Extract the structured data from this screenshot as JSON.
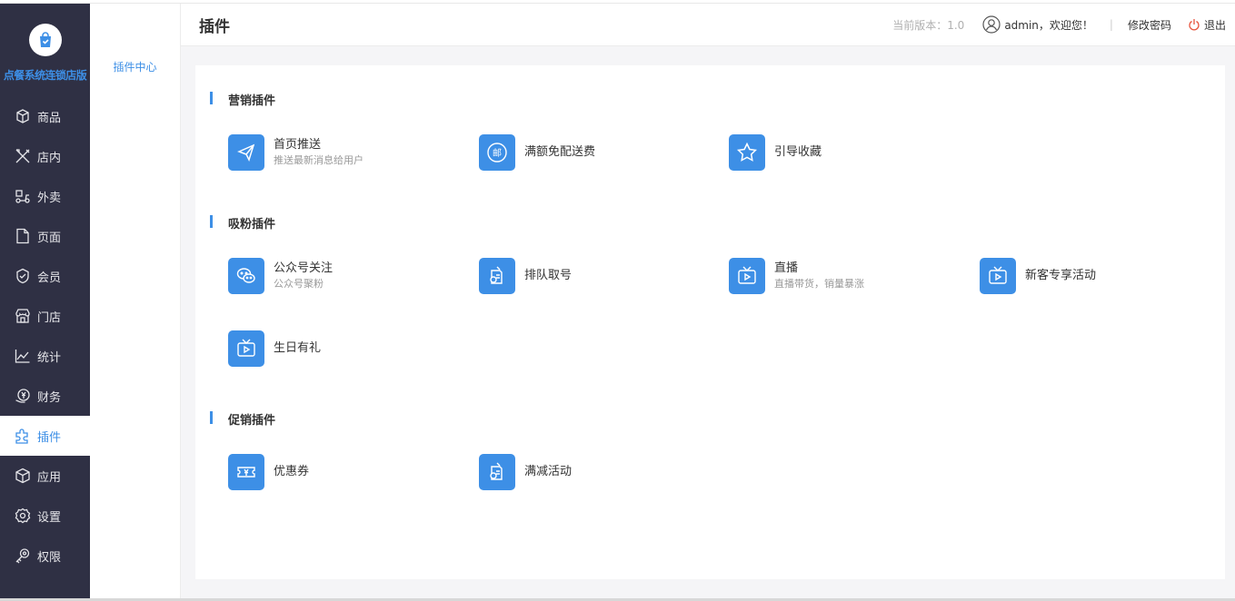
{
  "app": {
    "shop_name": "点餐系统连锁店版"
  },
  "nav": [
    {
      "label": "商品",
      "icon": "box-icon"
    },
    {
      "label": "店内",
      "icon": "utensils-icon"
    },
    {
      "label": "外卖",
      "icon": "scooter-icon"
    },
    {
      "label": "页面",
      "icon": "page-icon"
    },
    {
      "label": "会员",
      "icon": "member-icon"
    },
    {
      "label": "门店",
      "icon": "store-icon"
    },
    {
      "label": "统计",
      "icon": "chart-icon"
    },
    {
      "label": "财务",
      "icon": "finance-icon"
    },
    {
      "label": "插件",
      "icon": "puzzle-icon",
      "active": true
    },
    {
      "label": "应用",
      "icon": "cube-icon"
    },
    {
      "label": "设置",
      "icon": "gear-icon"
    },
    {
      "label": "权限",
      "icon": "key-icon"
    }
  ],
  "subnav": {
    "item": "插件中心"
  },
  "header": {
    "title": "插件",
    "version": "当前版本：1.0",
    "user": "admin，欢迎您！",
    "separator": "|",
    "change_password": "修改密码",
    "logout": "退出"
  },
  "sections": {
    "marketing": {
      "title": "营销插件",
      "items": [
        {
          "name": "首页推送",
          "desc": "推送最新消息给用户",
          "icon": "send-icon"
        },
        {
          "name": "满额免配送费",
          "desc": "",
          "icon": "mail-badge-icon"
        },
        {
          "name": "引导收藏",
          "desc": "",
          "icon": "star-icon"
        }
      ]
    },
    "fans": {
      "title": "吸粉插件",
      "items": [
        {
          "name": "公众号关注",
          "desc": "公众号聚粉",
          "icon": "wechat-icon"
        },
        {
          "name": "排队取号",
          "desc": "",
          "icon": "queue-ticket-icon"
        },
        {
          "name": "直播",
          "desc": "直播带货，销量暴涨",
          "icon": "live-tv-icon"
        },
        {
          "name": "新客专享活动",
          "desc": "",
          "icon": "live-tv-icon"
        },
        {
          "name": "生日有礼",
          "desc": "",
          "icon": "live-tv-icon"
        }
      ]
    },
    "promo": {
      "title": "促销插件",
      "items": [
        {
          "name": "优惠券",
          "desc": "",
          "icon": "coupon-icon"
        },
        {
          "name": "满减活动",
          "desc": "",
          "icon": "queue-ticket-icon"
        }
      ]
    }
  },
  "colors": {
    "sidebar_bg": "#2f3044",
    "accent": "#3d8fe6"
  }
}
